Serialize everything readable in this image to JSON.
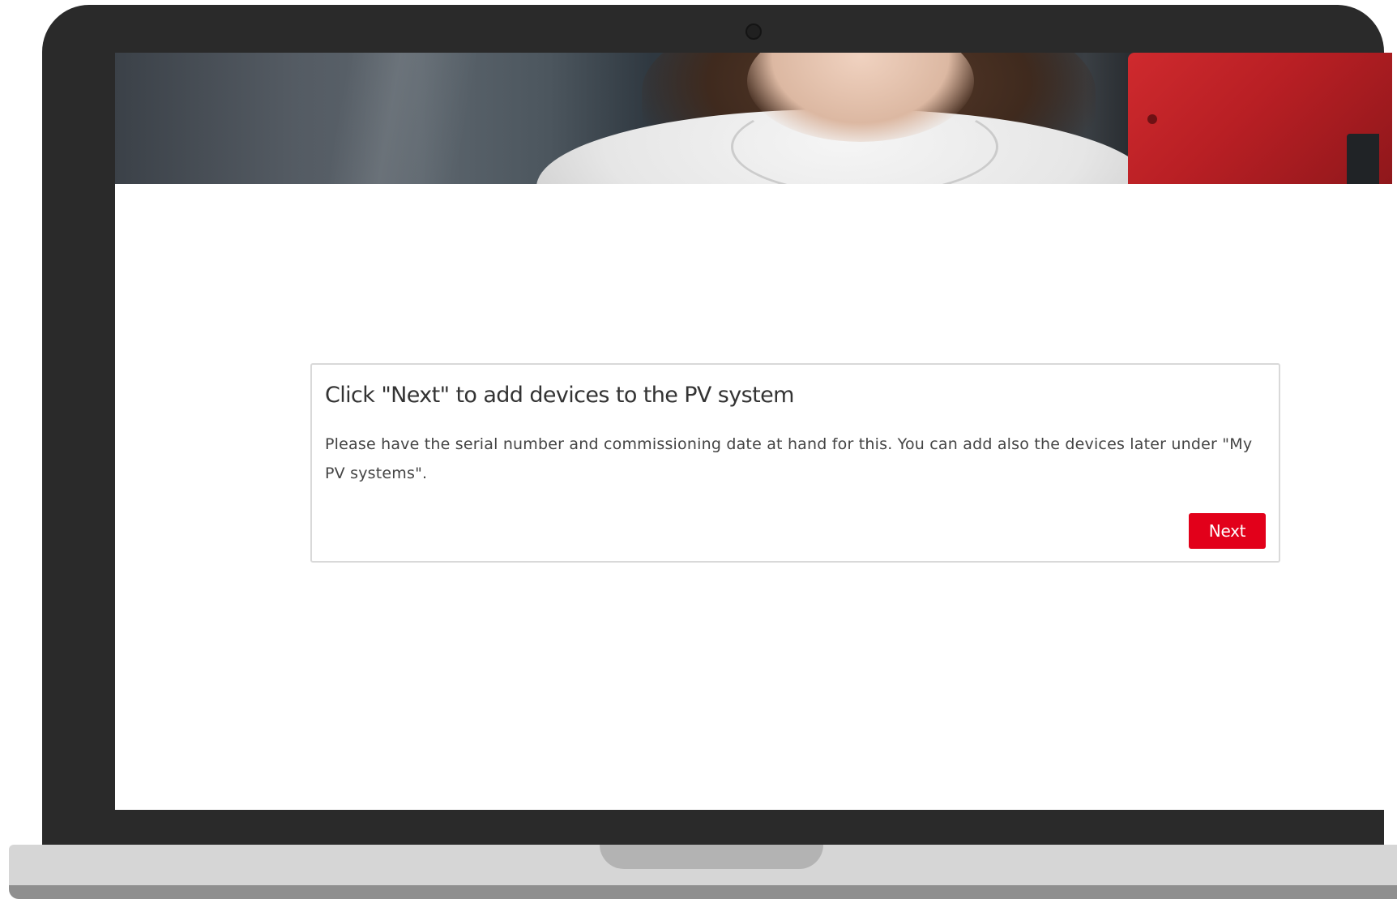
{
  "dialog": {
    "title": "Click \"Next\" to add devices to the PV system",
    "body": "Please have the serial number and commissioning date at hand for this. You can add also the devices later under \"My PV systems\".",
    "next_label": "Next"
  },
  "colors": {
    "accent": "#e2001a",
    "bezel": "#2a2a2a",
    "card_border": "#d9d9d9"
  },
  "icons": {
    "camera": "webcam-icon"
  }
}
